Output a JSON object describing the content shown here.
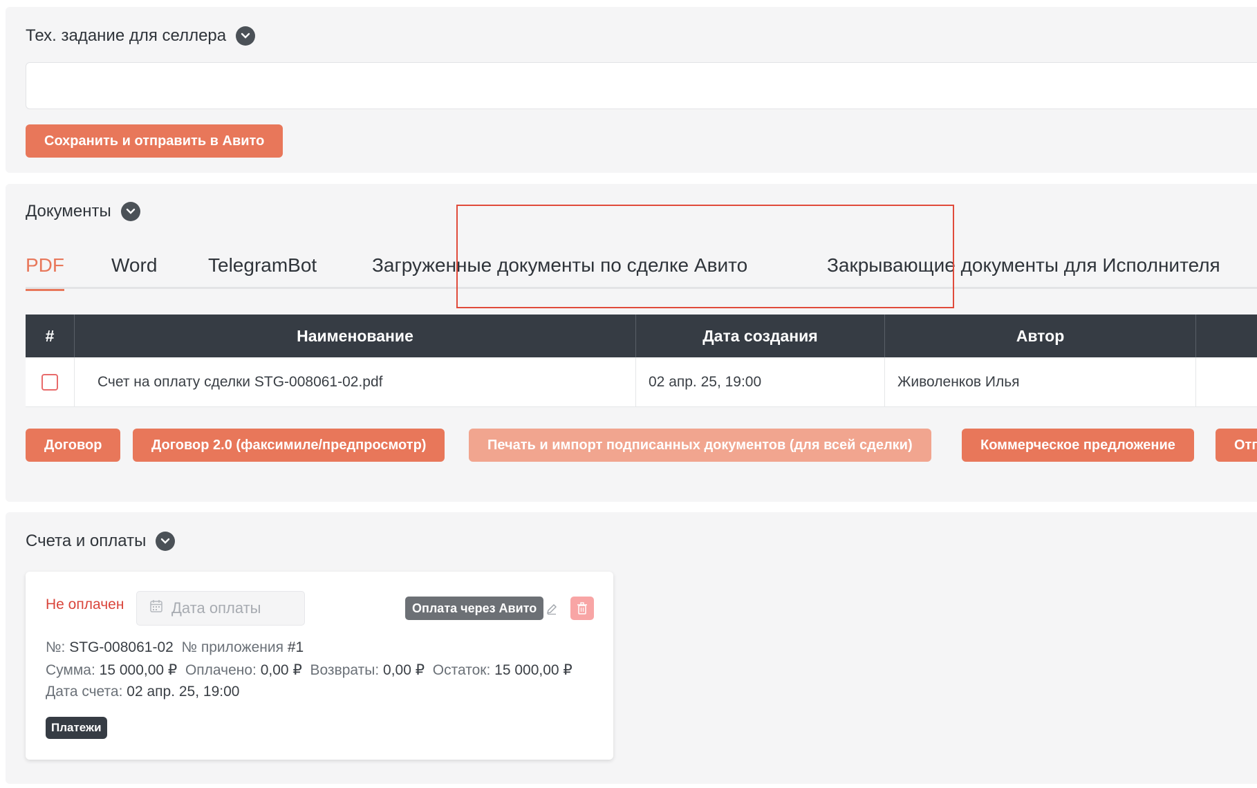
{
  "spec": {
    "title": "Тех. задание для селлера",
    "input_value": "",
    "save_button": "Сохранить и отправить в Авито"
  },
  "documents": {
    "title": "Документы",
    "tabs": [
      {
        "label": "PDF",
        "active": true
      },
      {
        "label": "Word"
      },
      {
        "label": "TelegramBot"
      },
      {
        "label": "Загруженные документы по сделке Авито"
      },
      {
        "label": "Закрывающие документы для Исполнителя"
      }
    ],
    "table": {
      "headers": [
        "#",
        "Наименование",
        "Дата создания",
        "Автор"
      ],
      "rows": [
        {
          "name": "Счет на оплату сделки STG-008061-02.pdf",
          "date": "02 апр. 25, 19:00",
          "author": "Живоленков Илья"
        }
      ]
    },
    "buttons": [
      "Договор",
      "Договор 2.0 (факсимиле/предпросмотр)",
      "Печать и импорт подписанных документов (для всей сделки)",
      "Коммерческое предложение",
      "Отг"
    ]
  },
  "bills": {
    "title": "Счета и оплаты",
    "card": {
      "status": "Не оплачен",
      "date_placeholder": "Дата оплаты",
      "avito_badge": "Оплата через Авито",
      "number_label": "№:",
      "number": "STG-008061-02",
      "appendix_label": "№ приложения",
      "appendix": "#1",
      "sum_label": "Сумма:",
      "sum": "15 000,00 ₽",
      "paid_label": "Оплачено:",
      "paid": "0,00 ₽",
      "refunds_label": "Возвраты:",
      "refunds": "0,00 ₽",
      "rest_label": "Остаток:",
      "rest": "15 000,00 ₽",
      "date_label": "Дата счета:",
      "date": "02 апр. 25, 19:00",
      "payments_badge": "Платежи"
    }
  },
  "colors": {
    "accent": "#e8775a",
    "header_dark": "#363c44",
    "danger": "#d9453b",
    "panel_bg": "#f5f5f6"
  }
}
